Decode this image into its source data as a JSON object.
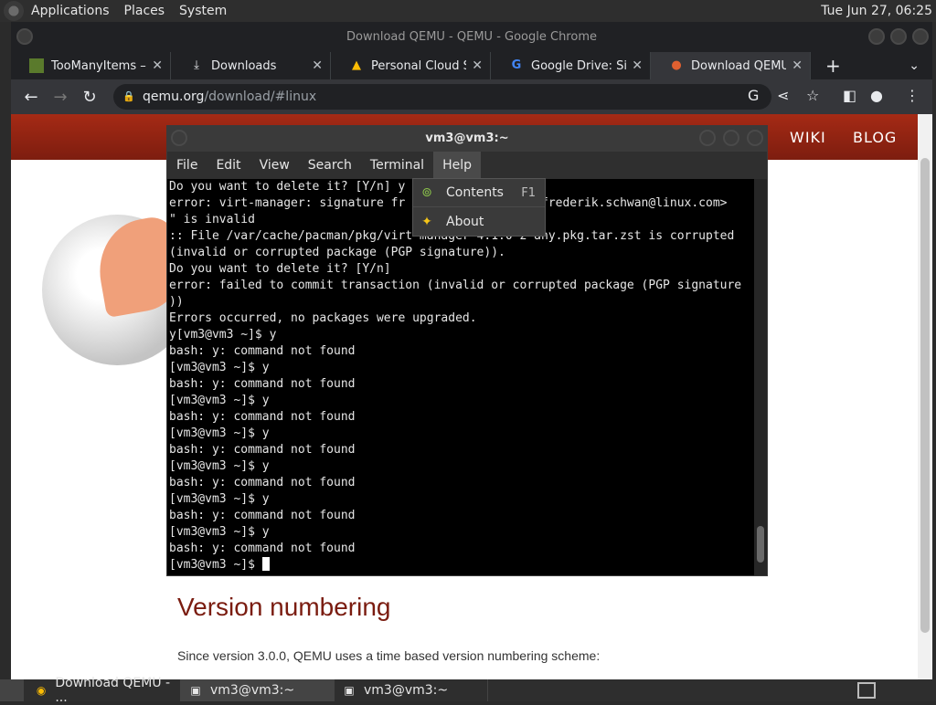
{
  "top_panel": {
    "menus": [
      "Applications",
      "Places",
      "System"
    ],
    "clock": "Tue Jun 27, 06:25"
  },
  "chrome": {
    "title": "Download QEMU - QEMU - Google Chrome",
    "tabs": [
      {
        "label": "TooManyItems – M",
        "icon": "minecraft-icon"
      },
      {
        "label": "Downloads",
        "icon": "download-icon"
      },
      {
        "label": "Personal Cloud Sto",
        "icon": "google-drive-icon"
      },
      {
        "label": "Google Drive: Sign-",
        "icon": "google-icon"
      },
      {
        "label": "Download QEMU -",
        "icon": "qemu-icon"
      }
    ],
    "url_host": "qemu.org",
    "url_path": "/download/#linux"
  },
  "site": {
    "nav": [
      "WIKI",
      "BLOG"
    ],
    "heading": "Version numbering",
    "paragraph": "Since version 3.0.0, QEMU uses a time based version numbering scheme:"
  },
  "terminal": {
    "title": "vm3@vm3:~",
    "menus": [
      "File",
      "Edit",
      "View",
      "Search",
      "Terminal",
      "Help"
    ],
    "lines": [
      "Do you want to delete it? [Y/n] y",
      "error: virt-manager: signature fr                n <frederik.schwan@linux.com>",
      "\" is invalid",
      ":: File /var/cache/pacman/pkg/virt-manager-4.1.0-2-any.pkg.tar.zst is corrupted",
      "(invalid or corrupted package (PGP signature)).",
      "Do you want to delete it? [Y/n]",
      "error: failed to commit transaction (invalid or corrupted package (PGP signature",
      "))",
      "Errors occurred, no packages were upgraded.",
      "y[vm3@vm3 ~]$ y",
      "bash: y: command not found",
      "[vm3@vm3 ~]$ y",
      "bash: y: command not found",
      "[vm3@vm3 ~]$ y",
      "bash: y: command not found",
      "[vm3@vm3 ~]$ y",
      "bash: y: command not found",
      "[vm3@vm3 ~]$ y",
      "bash: y: command not found",
      "[vm3@vm3 ~]$ y",
      "bash: y: command not found",
      "[vm3@vm3 ~]$ y",
      "bash: y: command not found"
    ],
    "prompt": "[vm3@vm3 ~]$ "
  },
  "help_menu": {
    "items": [
      {
        "label": "Contents",
        "accel": "F1",
        "icon": "help-contents-icon"
      },
      {
        "label": "About",
        "accel": "",
        "icon": "about-icon"
      }
    ]
  },
  "taskbar": {
    "tasks": [
      "Download QEMU - ...",
      "vm3@vm3:~",
      "vm3@vm3:~"
    ]
  }
}
